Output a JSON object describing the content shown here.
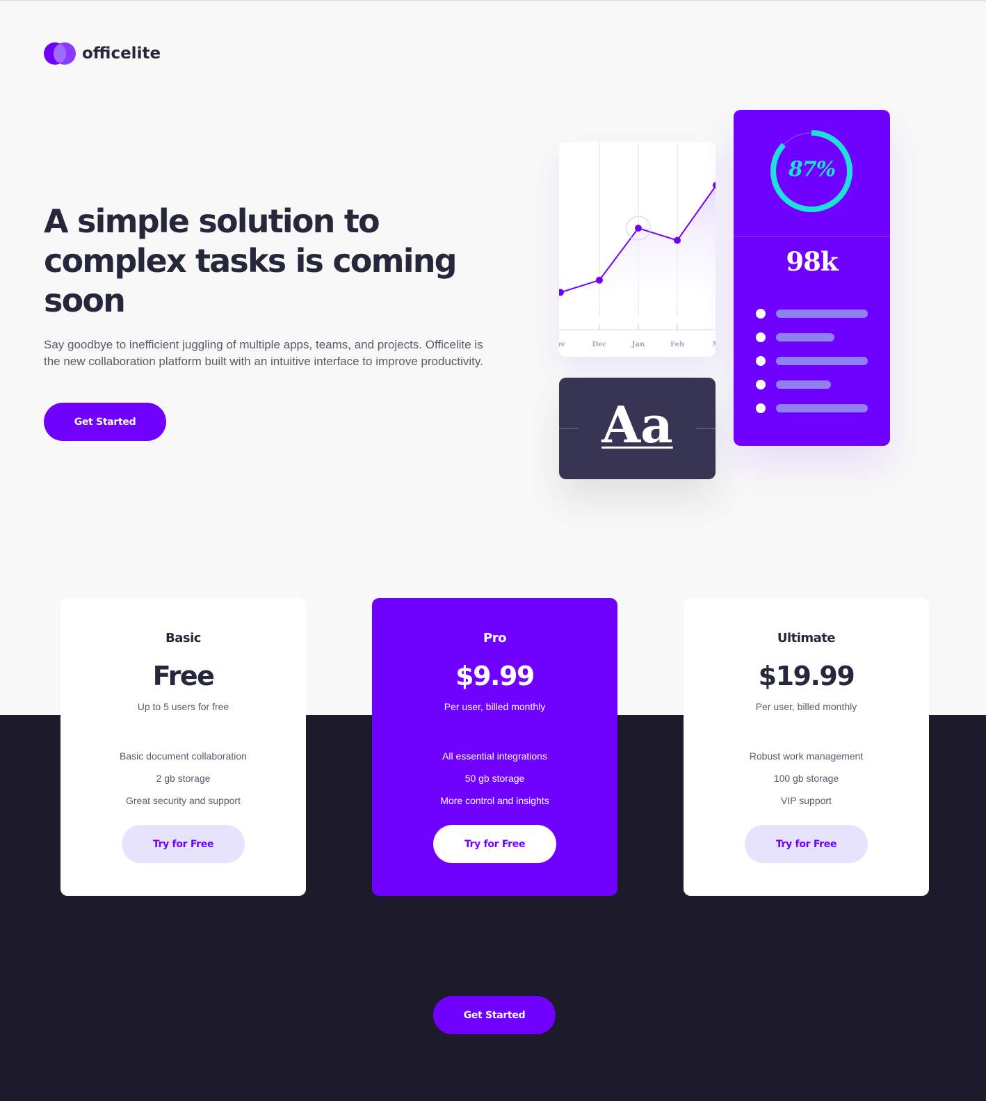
{
  "brand": {
    "name": "officelite"
  },
  "hero": {
    "title": "A simple solution to complex tasks is coming soon",
    "description": "Say goodbye to inefficient juggling of multiple apps, teams, and projects. Officelite is the new collaboration platform built with an intuitive interface to improve productivity.",
    "cta_label": "Get Started"
  },
  "illustration": {
    "chart_data": {
      "type": "line",
      "categories": [
        "Nov",
        "Dec",
        "Jan",
        "Feb",
        "Mar"
      ],
      "x_labels": [
        "ov",
        "Dec",
        "Jan",
        "Feb",
        "M"
      ],
      "values": [
        18,
        26,
        60,
        52,
        88
      ],
      "ylim": [
        0,
        100
      ],
      "highlight_index": 2
    },
    "progress": {
      "label": "87%",
      "value": 0.87
    },
    "stat_value": "98k",
    "type_sample": "Aa",
    "list_fills": [
      1.0,
      0.64,
      1.0,
      0.6,
      1.0
    ]
  },
  "plans": [
    {
      "name": "Basic",
      "price": "Free",
      "subtitle": "Up to 5 users for free",
      "features": [
        "Basic document collaboration",
        "2 gb storage",
        "Great security and support"
      ],
      "cta_label": "Try for Free"
    },
    {
      "name": "Pro",
      "price": "$9.99",
      "subtitle": "Per user, billed monthly",
      "features": [
        "All essential integrations",
        "50 gb storage",
        "More control and insights"
      ],
      "cta_label": "Try for Free"
    },
    {
      "name": "Ultimate",
      "price": "$19.99",
      "subtitle": "Per user, billed monthly",
      "features": [
        "Robust work management",
        "100 gb storage",
        "VIP support"
      ],
      "cta_label": "Try for Free"
    }
  ],
  "footer": {
    "cta_label": "Get Started"
  },
  "colors": {
    "accent": "#7000ff",
    "dark": "#25273b",
    "dark_band": "#1d1b2b",
    "light_bg": "#f8f8f8",
    "progress_ring": "#1ee0d8",
    "soft_button": "#e6e3ff",
    "list_bar": "#8f81f2"
  }
}
